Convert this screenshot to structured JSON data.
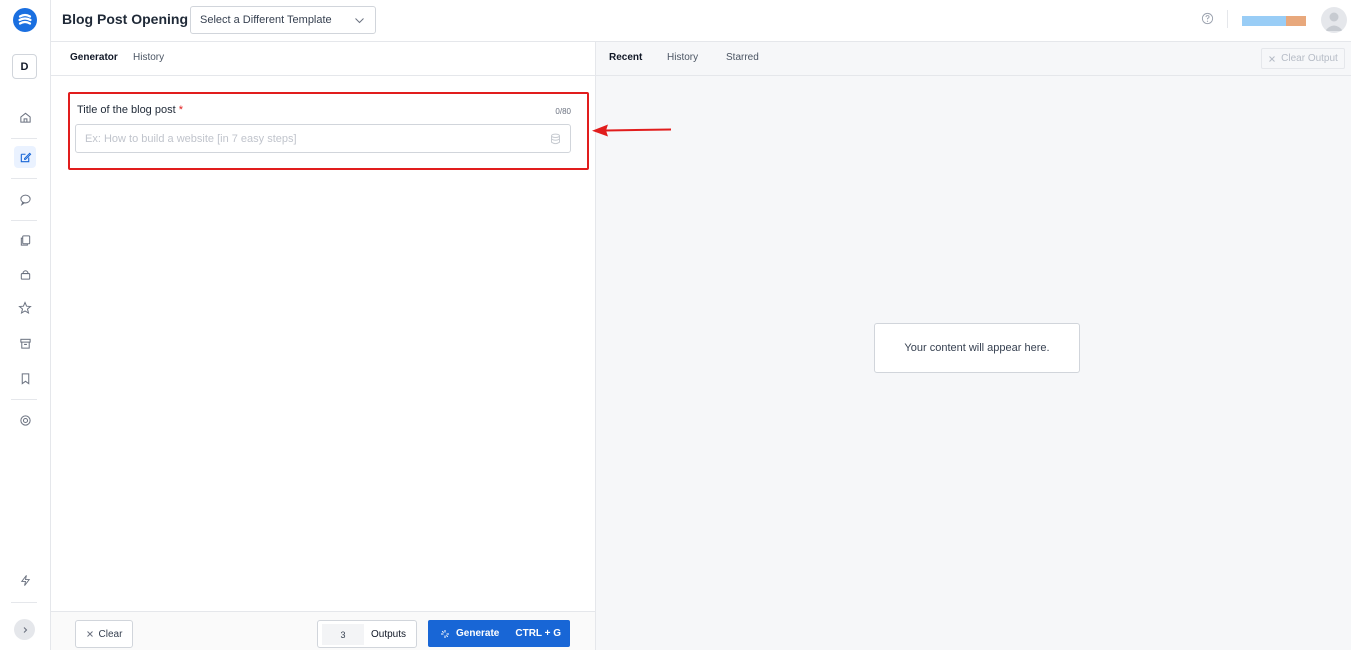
{
  "header": {
    "title": "Blog Post Opening",
    "template_select": "Select a Different Template"
  },
  "rail": {
    "workspace_initial": "D",
    "items": [
      "home-icon",
      "edit-icon",
      "chat-icon",
      "copy-icon",
      "lock-icon",
      "star-icon",
      "archive-icon",
      "bookmark-icon",
      "support-icon",
      "bolt-icon"
    ]
  },
  "usage": {
    "used_fraction": 0.68,
    "second_fraction": 0.32,
    "colors": [
      "#99cdf6",
      "#e8a87c"
    ]
  },
  "left": {
    "tabs": [
      "Generator",
      "History"
    ],
    "active_tab": "Generator",
    "field": {
      "label": "Title of the blog post",
      "required_mark": "*",
      "counter": "0/80",
      "placeholder": "Ex: How to build a website [in 7 easy steps]",
      "value": ""
    },
    "footer": {
      "clear_label": "Clear",
      "outputs_count": "3",
      "outputs_label": "Outputs",
      "generate_label": "Generate",
      "shortcut": "CTRL + G"
    }
  },
  "right": {
    "tabs": [
      "Recent",
      "History",
      "Starred"
    ],
    "active_tab": "Recent",
    "clear_output_label": "Clear Output",
    "placeholder": "Your content will appear here."
  },
  "colors": {
    "accent": "#1866d6",
    "highlight_border": "#e11d1d",
    "annotation_arrow": "#e11d1d"
  }
}
